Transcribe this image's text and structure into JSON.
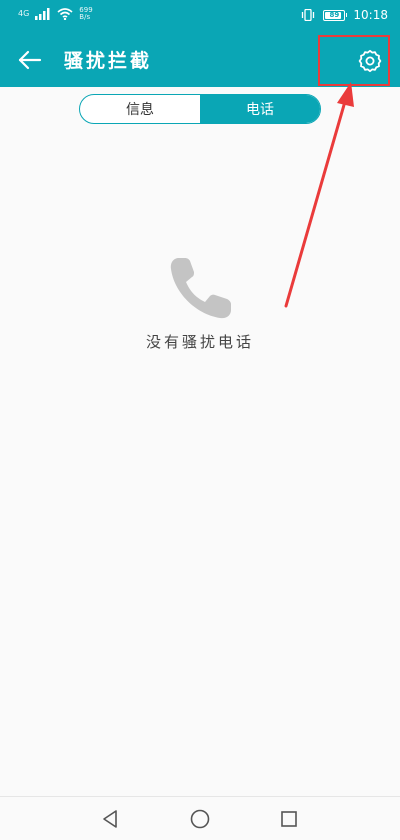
{
  "status_bar": {
    "signal_tag": "4G",
    "net_speed_value": "699",
    "net_speed_unit": "B/s",
    "battery_level": "89",
    "time": "10:18"
  },
  "app_bar": {
    "title": "骚扰拦截"
  },
  "tabs": {
    "messages": "信息",
    "calls": "电话",
    "selected": "calls"
  },
  "empty_state": {
    "icon": "phone-icon",
    "message": "没有骚扰电话"
  },
  "icons": {
    "back": "arrow-left-icon",
    "settings": "gear-icon",
    "nav_back": "triangle-back-icon",
    "nav_home": "circle-home-icon",
    "nav_recents": "square-recents-icon"
  },
  "colors": {
    "primary": "#0aa6b5",
    "annotation": "#ea3b3b",
    "background": "#fafafa",
    "empty_icon": "#c4c4c4"
  }
}
